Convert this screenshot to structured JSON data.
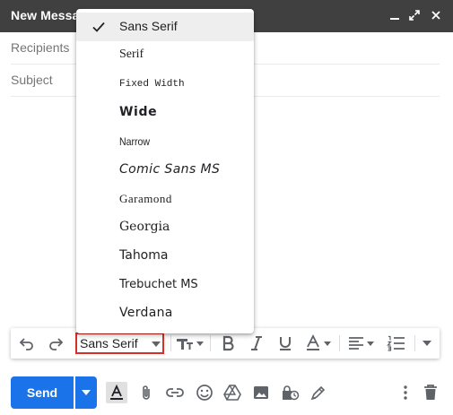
{
  "window": {
    "title": "New Message"
  },
  "compose": {
    "recipients_placeholder": "Recipients",
    "subject_placeholder": "Subject"
  },
  "font_menu": {
    "items": [
      {
        "label": "Sans Serif",
        "selected": true
      },
      {
        "label": "Serif",
        "selected": false
      },
      {
        "label": "Fixed Width",
        "selected": false
      },
      {
        "label": "Wide",
        "selected": false
      },
      {
        "label": "Narrow",
        "selected": false
      },
      {
        "label": "Comic Sans MS",
        "selected": false
      },
      {
        "label": "Garamond",
        "selected": false
      },
      {
        "label": "Georgia",
        "selected": false
      },
      {
        "label": "Tahoma",
        "selected": false
      },
      {
        "label": "Trebuchet MS",
        "selected": false
      },
      {
        "label": "Verdana",
        "selected": false
      }
    ]
  },
  "toolbar": {
    "font_value": "Sans Serif"
  },
  "bottom": {
    "send_label": "Send"
  },
  "colors": {
    "title_bar": "#404040",
    "send_button": "#1a73e8",
    "highlight": "#d93025",
    "icon": "#5f6368"
  }
}
